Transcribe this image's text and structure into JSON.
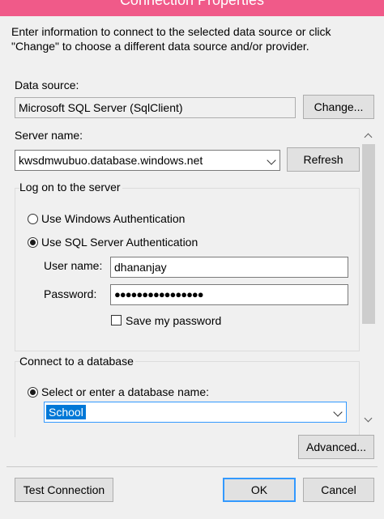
{
  "window": {
    "title": "Connection Properties"
  },
  "intro": "Enter information to connect to the selected data source or click \"Change\" to choose a different data source and/or provider.",
  "data_source": {
    "label": "Data source:",
    "value": "Microsoft SQL Server (SqlClient)",
    "change_button": "Change..."
  },
  "server": {
    "label": "Server name:",
    "value": "kwsdmwubuo.database.windows.net",
    "refresh_button": "Refresh"
  },
  "logon": {
    "title": "Log on to the server",
    "windows_auth": "Use Windows Authentication",
    "sql_auth": "Use SQL Server Authentication",
    "user_label": "User name:",
    "user_value": "dhananjay",
    "password_label": "Password:",
    "password_value": "●●●●●●●●●●●●●●●●",
    "save_password": "Save my password"
  },
  "database": {
    "title": "Connect to a database",
    "select_label": "Select or enter a database name:",
    "value": "School"
  },
  "buttons": {
    "advanced": "Advanced...",
    "test": "Test Connection",
    "ok": "OK",
    "cancel": "Cancel"
  }
}
